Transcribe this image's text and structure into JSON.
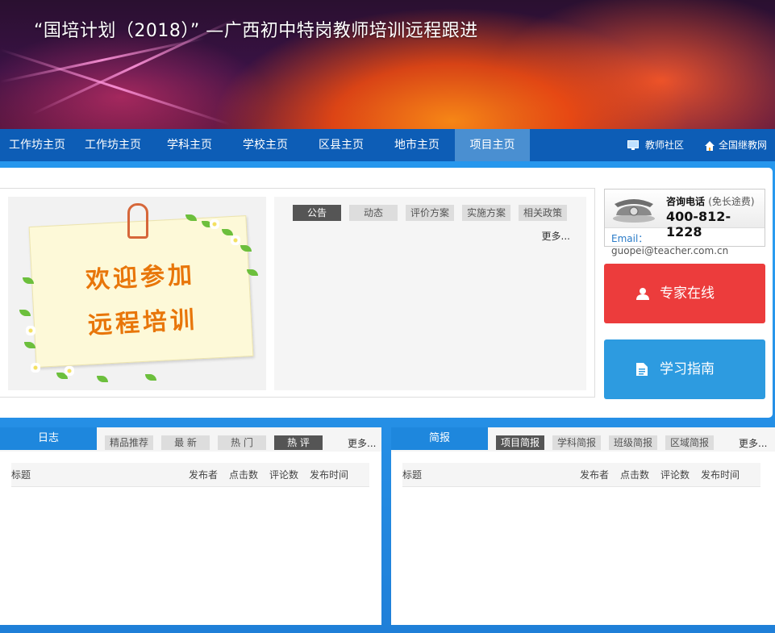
{
  "banner": {
    "title": "“国培计划（2018）” —广西初中特岗教师培训远程跟进"
  },
  "nav": {
    "items": [
      "工作坊主页",
      "工作坊主页",
      "学科主页",
      "学校主页",
      "区县主页",
      "地市主页",
      "项目主页"
    ],
    "active_index": 6,
    "right": [
      "教师社区",
      "全国继教网"
    ]
  },
  "welcome": {
    "line1": "欢迎参加",
    "line2": "远程培训"
  },
  "news": {
    "tabs": [
      "公告",
      "动态",
      "评价方案",
      "实施方案",
      "相关政策"
    ],
    "active_index": 0,
    "more": "更多..."
  },
  "contact": {
    "label": "咨询电话",
    "label_note": "(免长途费)",
    "phone": "400-812-1228",
    "email_label": "Email：",
    "email": "guopei@teacher.com.cn"
  },
  "buttons": {
    "expert": "专家在线",
    "guide": "学习指南"
  },
  "diary": {
    "title": "日志",
    "tabs": [
      "精品推荐",
      "最 新",
      "热 门",
      "热 评"
    ],
    "active_index": 3,
    "more": "更多...",
    "columns": [
      "标题",
      "发布者",
      "点击数",
      "评论数",
      "发布时间"
    ]
  },
  "brief": {
    "title": "简报",
    "tabs": [
      "项目简报",
      "学科简报",
      "班级简报",
      "区域简报"
    ],
    "active_index": 0,
    "more": "更多...",
    "columns": [
      "标题",
      "发布者",
      "点击数",
      "评论数",
      "发布时间"
    ]
  },
  "colors": {
    "nav": "#0d5db6",
    "nav_active": "#4a8fd1",
    "expert": "#ec3c3c",
    "guide": "#2d9be0",
    "panel_title": "#1e87dd"
  }
}
